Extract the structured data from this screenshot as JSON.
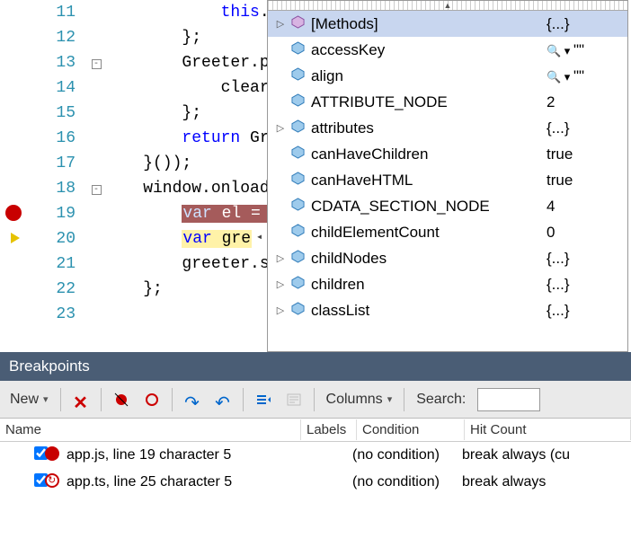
{
  "editor": {
    "lines": [
      {
        "num": 11,
        "glyph": "",
        "fold": "",
        "html": "            <span class='kw'>this</span>."
      },
      {
        "num": 12,
        "glyph": "",
        "fold": "",
        "html": "        };"
      },
      {
        "num": 13,
        "glyph": "",
        "fold": "box-",
        "html": "        Greeter.p"
      },
      {
        "num": 14,
        "glyph": "",
        "fold": "",
        "html": "            clear"
      },
      {
        "num": 15,
        "glyph": "",
        "fold": "",
        "html": "        };"
      },
      {
        "num": 16,
        "glyph": "",
        "fold": "",
        "html": "        <span class='kw'>return</span> Gr"
      },
      {
        "num": 17,
        "glyph": "",
        "fold": "",
        "html": "    }());"
      },
      {
        "num": 18,
        "glyph": "",
        "fold": "box-",
        "html": "    window.onload"
      },
      {
        "num": 19,
        "glyph": "bp",
        "fold": "",
        "html": "        <span class='hl-red'><span style='color:#cfe1ff'>var</span> el = </span>"
      },
      {
        "num": 20,
        "glyph": "arrow",
        "fold": "",
        "html": "        <span class='hl-yel'><span class='kw'>var</span> gre</span>"
      },
      {
        "num": 21,
        "glyph": "",
        "fold": "",
        "html": "        greeter.s"
      },
      {
        "num": 22,
        "glyph": "",
        "fold": "",
        "html": "    };"
      },
      {
        "num": 23,
        "glyph": "",
        "fold": "",
        "html": ""
      }
    ]
  },
  "intellisense": {
    "items": [
      {
        "expand": "▷",
        "icon": "method",
        "name": "[Methods]",
        "value": "{...}",
        "selected": true,
        "valGlyph": ""
      },
      {
        "expand": "",
        "icon": "prop",
        "name": "accessKey",
        "value": "\"\"",
        "valGlyph": "search"
      },
      {
        "expand": "",
        "icon": "prop",
        "name": "align",
        "value": "\"\"",
        "valGlyph": "search"
      },
      {
        "expand": "",
        "icon": "prop",
        "name": "ATTRIBUTE_NODE",
        "value": "2",
        "valGlyph": ""
      },
      {
        "expand": "▷",
        "icon": "prop",
        "name": "attributes",
        "value": "{...}",
        "valGlyph": ""
      },
      {
        "expand": "",
        "icon": "prop",
        "name": "canHaveChildren",
        "value": "true",
        "valGlyph": ""
      },
      {
        "expand": "",
        "icon": "prop",
        "name": "canHaveHTML",
        "value": "true",
        "valGlyph": ""
      },
      {
        "expand": "",
        "icon": "prop",
        "name": "CDATA_SECTION_NODE",
        "value": "4",
        "valGlyph": ""
      },
      {
        "expand": "",
        "icon": "prop",
        "name": "childElementCount",
        "value": "0",
        "valGlyph": ""
      },
      {
        "expand": "▷",
        "icon": "prop",
        "name": "childNodes",
        "value": "{...}",
        "valGlyph": ""
      },
      {
        "expand": "▷",
        "icon": "prop",
        "name": "children",
        "value": "{...}",
        "valGlyph": ""
      },
      {
        "expand": "▷",
        "icon": "prop",
        "name": "classList",
        "value": "{...}",
        "valGlyph": ""
      }
    ],
    "collapse_glyph": "◂"
  },
  "breakpoints": {
    "title": "Breakpoints",
    "toolbar": {
      "new_label": "New",
      "columns_label": "Columns",
      "search_label": "Search:"
    },
    "columns": {
      "name": "Name",
      "labels": "Labels",
      "condition": "Condition",
      "hitcount": "Hit Count"
    },
    "rows": [
      {
        "checked": true,
        "icon": "solid",
        "desc": "app.js, line 19 character 5",
        "labels": "",
        "cond": "(no condition)",
        "hit": "break always (cu"
      },
      {
        "checked": true,
        "icon": "map",
        "desc": "app.ts, line 25 character 5",
        "labels": "",
        "cond": "(no condition)",
        "hit": "break always"
      }
    ]
  }
}
